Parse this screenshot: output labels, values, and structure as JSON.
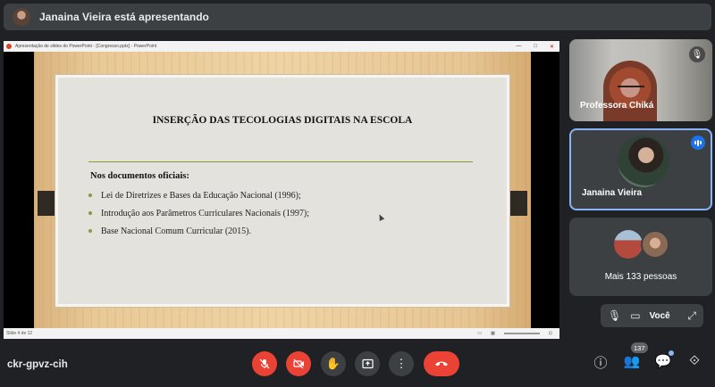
{
  "topbar": {
    "presenter_text": "Janaina Vieira está apresentando"
  },
  "ppt": {
    "window_title": "Apresentação de slides do PowerPoint - [Congresso.pptx] - PowerPoint",
    "window_controls": [
      "—",
      "□",
      "✕"
    ],
    "status_left": "Slide 4 de 12",
    "slide": {
      "heading": "INSERÇÃO DAS TECOLOGIAS DIGITAIS NA ESCOLA",
      "subheading": "Nos documentos oficiais:",
      "bullets": [
        "Lei de Diretrizes e Bases da Educação Nacional (1996);",
        "Introdução aos Parâmetros Curriculares Nacionais (1997);",
        "Base Nacional Comum Curricular  (2015)."
      ]
    }
  },
  "participants": {
    "tile1_name": "Professora Chiká",
    "tile2_name": "Janaina Vieira",
    "tile3_name": "Mais 133 pessoas"
  },
  "selfview": {
    "label": "Você"
  },
  "bottombar": {
    "meeting_code": "ckr-gpvz-cih",
    "people_count": "137"
  },
  "colors": {
    "end_call": "#ea4335",
    "highlight": "#8ab4f8",
    "speaking": "#1a73e8"
  }
}
